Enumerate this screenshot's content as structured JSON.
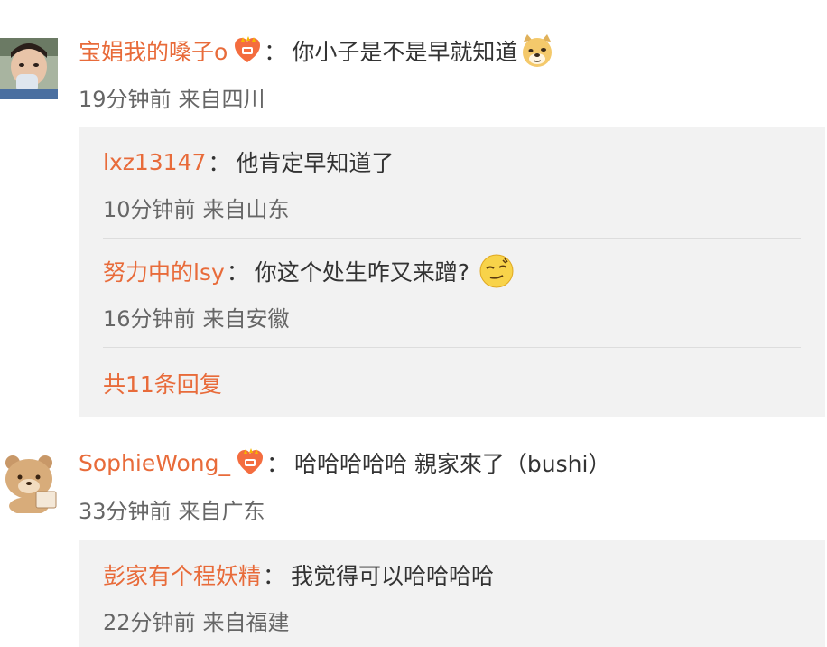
{
  "comments": [
    {
      "username": "宝娟我的嗓子o",
      "colon": "：",
      "text": "你小子是不是早就知道",
      "badge_icon": "fan-badge-icon",
      "emoji_icon": "doge-emoji-icon",
      "time": "19分钟前",
      "location": "来自四川",
      "replies": [
        {
          "username": "lxz13147",
          "colon": "：",
          "text": "他肯定早知道了",
          "time": "10分钟前",
          "location": "来自山东"
        },
        {
          "username": "努力中的lsy",
          "colon": "：",
          "text": "你这个处生咋又来蹭?",
          "emoji_icon": "smirk-emoji-icon",
          "time": "16分钟前",
          "location": "来自安徽"
        }
      ],
      "more_replies": "共11条回复"
    },
    {
      "username": "SophieWong_",
      "colon": "：",
      "text": "哈哈哈哈哈 親家來了（bushi）",
      "badge_icon": "fan-badge-icon",
      "time": "33分钟前",
      "location": "来自广东",
      "replies": [
        {
          "username": "彭家有个程妖精",
          "colon": "：",
          "text": "我觉得可以哈哈哈哈",
          "time": "22分钟前",
          "location": "来自福建"
        }
      ]
    }
  ],
  "colors": {
    "username": "#e86b3a",
    "text": "#333333",
    "meta": "#666666",
    "reply_bg": "#f2f2f2"
  }
}
